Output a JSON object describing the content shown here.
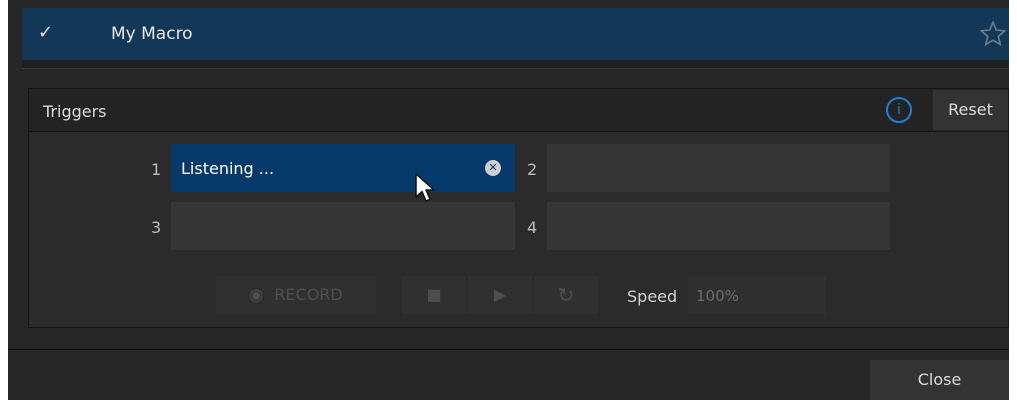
{
  "macro_list": {
    "selected_check": "✓",
    "selected_name": "My Macro",
    "star_icon": "star-outline"
  },
  "triggers": {
    "title": "Triggers",
    "info_icon": "i",
    "reset_label": "Reset",
    "slots": [
      {
        "number": "1",
        "value": "Listening ...",
        "active": true
      },
      {
        "number": "2",
        "value": ""
      },
      {
        "number": "3",
        "value": ""
      },
      {
        "number": "4",
        "value": ""
      }
    ],
    "clear_glyph": "✕"
  },
  "controls": {
    "record_label": "RECORD",
    "record_icon": "◉",
    "stop_icon": "■",
    "play_icon": "▶",
    "loop_icon": "↻",
    "speed_label": "Speed",
    "speed_value": "100%"
  },
  "footer": {
    "close_label": "Close"
  },
  "colors": {
    "accent_blue": "#1e7fd6",
    "active_field": "#063a6c",
    "selected_row": "#133857"
  }
}
